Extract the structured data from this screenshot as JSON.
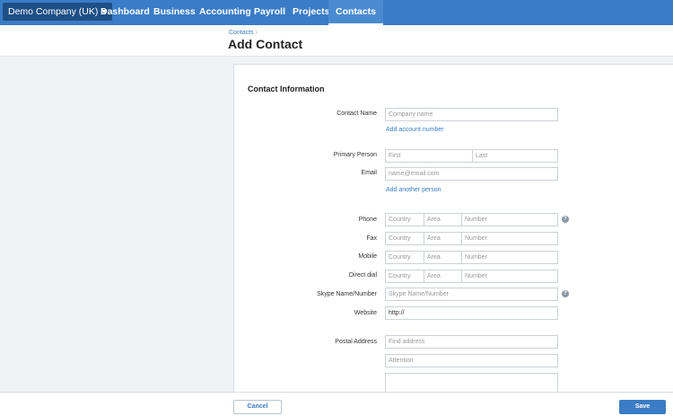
{
  "nav": {
    "company": "Demo Company (UK)",
    "items": [
      "Dashboard",
      "Business",
      "Accounting",
      "Payroll",
      "Projects",
      "Contacts"
    ]
  },
  "header": {
    "breadcrumb": "Contacts",
    "breadcrumb_sep": "›",
    "title": "Add Contact"
  },
  "form": {
    "section_title": "Contact Information",
    "contact_name": {
      "label": "Contact Name",
      "placeholder": "Company name"
    },
    "add_account_number": "Add account number",
    "primary_person": {
      "label": "Primary Person",
      "first": "First",
      "last": "Last"
    },
    "email": {
      "label": "Email",
      "placeholder": "name@email.com"
    },
    "add_another_person": "Add another person",
    "phone": {
      "label": "Phone"
    },
    "fax": {
      "label": "Fax"
    },
    "mobile": {
      "label": "Mobile"
    },
    "direct_dial": {
      "label": "Direct dial"
    },
    "phone_parts": {
      "country": "Country",
      "area": "Area",
      "number": "Number"
    },
    "skype": {
      "label": "Skype Name/Number",
      "placeholder": "Skype Name/Number"
    },
    "website": {
      "label": "Website",
      "value": "http://"
    },
    "postal_address": {
      "label": "Postal Address",
      "find": "Find address",
      "attention": "Attention"
    },
    "help_glyph": "?"
  },
  "footer": {
    "cancel": "Cancel",
    "save": "Save"
  },
  "colors": {
    "nav_bg": "#3a7cc6",
    "company_bg": "#1f4f86",
    "link": "#3a7cc6",
    "primary_button": "#3a7cc6"
  }
}
